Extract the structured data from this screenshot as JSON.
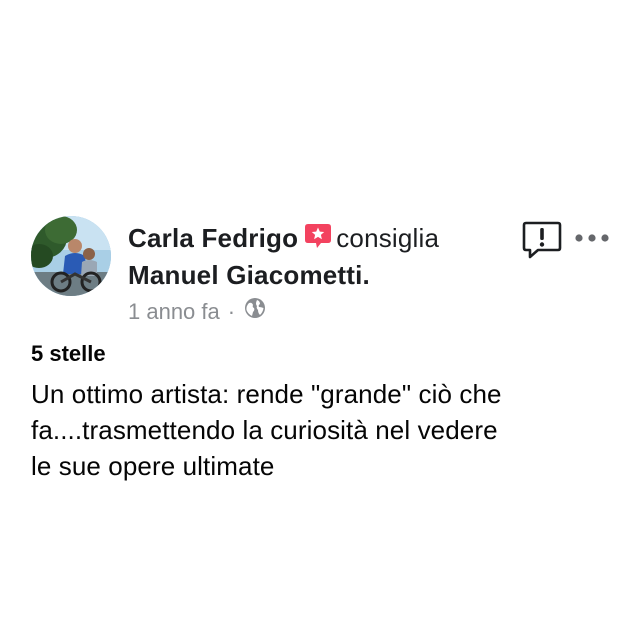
{
  "post": {
    "author": "Carla Fedrigo",
    "action": "consiglia",
    "target": "Manuel Giacometti.",
    "time": "1 anno fa",
    "separator": "·",
    "audience_icon": "globe-icon",
    "recommend_icon": "recommend-badge-icon",
    "rating": "5 stelle",
    "text": "Un ottimo artista: rende \"grande\" ciò che\nfa....trasmettendo la curiosità nel vedere\nle sue opere ultimate"
  },
  "actions": {
    "report_icon": "report-icon",
    "more_icon": "more-options-icon"
  },
  "colors": {
    "text": "#1c1e21",
    "meta": "#8a8d91",
    "recommend": "#f3425f"
  }
}
